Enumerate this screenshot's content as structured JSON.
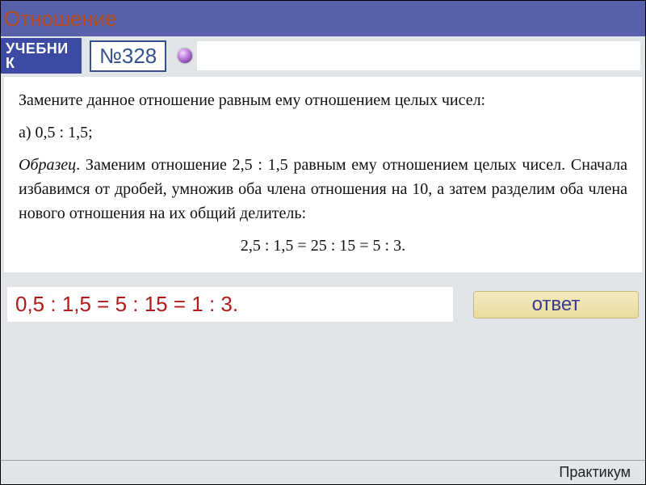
{
  "header": {
    "title": "Отношение"
  },
  "toolbar": {
    "textbook_label": "УЧЕБНИК",
    "problem_number": "№328"
  },
  "problem": {
    "prompt": "Замените данное отношение равным ему отношением целых чисел:",
    "part_a": "а) 0,5 : 1,5;",
    "example_label": "Образец",
    "example_body": ". Заменим отношение 2,5 : 1,5 равным ему отношением целых чисел. Сначала избавимся от дробей, умножив оба члена отношения на 10, а затем разделим оба члена нового отношения на их общий делитель:",
    "worked": "2,5 : 1,5 = 25 : 15 = 5 : 3."
  },
  "answer": {
    "text": "0,5 : 1,5 = 5 : 15 = 1 : 3.",
    "button_label": "ответ"
  },
  "footer": {
    "label": "Практикум"
  }
}
